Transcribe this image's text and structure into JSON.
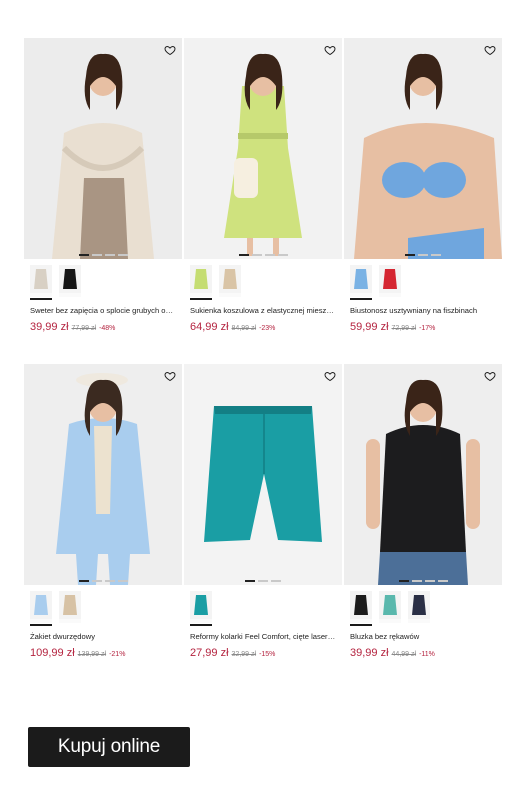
{
  "products": [
    {
      "name": "Sweter bez zapięcia o splocie grubych oc…",
      "price": "39,99 zł",
      "old_price": "77,99 zł",
      "discount": "-48%",
      "heart_icon": "heart-outline-icon",
      "photo_subject": "woman-knit-cardigan",
      "colors": {
        "bg": "#ececec",
        "main": "#e9dfd1",
        "accent": "#a99583"
      },
      "carousel_dots": 4,
      "carousel_active": 1,
      "swatches": [
        {
          "label": "beige-cardigan-swatch",
          "color": "#d8d0c4",
          "selected": true
        },
        {
          "label": "black-cardigan-swatch",
          "color": "#161616",
          "selected": false
        }
      ]
    },
    {
      "name": "Sukienka koszulowa z elastycznej miesza…",
      "price": "64,99 zł",
      "old_price": "84,99 zł",
      "discount": "-23%",
      "heart_icon": "heart-outline-icon",
      "photo_subject": "woman-lime-shirt-dress",
      "colors": {
        "bg": "#f2f2f2",
        "main": "#cfe27e",
        "accent": "#b6c96a"
      },
      "carousel_dots": 4,
      "carousel_active": 1,
      "swatches": [
        {
          "label": "lime-dress-swatch",
          "color": "#c5dd72",
          "selected": true
        },
        {
          "label": "beige-dress-swatch",
          "color": "#d9c4a6",
          "selected": false
        }
      ]
    },
    {
      "name": "Biustonosz usztywniany na fiszbinach",
      "price": "59,99 zł",
      "old_price": "72,99 zł",
      "discount": "-17%",
      "heart_icon": "heart-outline-icon",
      "photo_subject": "woman-blue-bra",
      "colors": {
        "bg": "#eeeeee",
        "main": "#6fa6de",
        "accent": "#c89272"
      },
      "carousel_dots": 3,
      "carousel_active": 1,
      "swatches": [
        {
          "label": "blue-bra-swatch",
          "color": "#7ab2e4",
          "selected": true
        },
        {
          "label": "red-bra-swatch",
          "color": "#d52631",
          "selected": false
        }
      ]
    },
    {
      "name": "Żakiet dwurzędowy",
      "price": "109,99 zł",
      "old_price": "139,99 zł",
      "discount": "-21%",
      "heart_icon": "heart-outline-icon",
      "photo_subject": "woman-light-blue-blazer",
      "colors": {
        "bg": "#eeeeee",
        "main": "#a9cdee",
        "accent": "#ece2cf"
      },
      "carousel_dots": 4,
      "carousel_active": 1,
      "swatches": [
        {
          "label": "light-blue-blazer-swatch",
          "color": "#a9cdee",
          "selected": true
        },
        {
          "label": "beige-blazer-swatch",
          "color": "#d7c2a5",
          "selected": false
        }
      ]
    },
    {
      "name": "Reformy kolarki Feel Comfort, cięte laser…",
      "price": "27,99 zł",
      "old_price": "32,99 zł",
      "discount": "-15%",
      "heart_icon": "heart-outline-icon",
      "photo_subject": "teal-cycling-shorts",
      "colors": {
        "bg": "#f3f3f3",
        "main": "#1a9ea4",
        "accent": "#137f85"
      },
      "carousel_dots": 3,
      "carousel_active": 1,
      "swatches": [
        {
          "label": "teal-shorts-swatch",
          "color": "#1a9ea4",
          "selected": true
        }
      ]
    },
    {
      "name": "Bluzka bez rękawów",
      "price": "39,99 zł",
      "old_price": "44,99 zł",
      "discount": "-11%",
      "heart_icon": "heart-outline-icon",
      "photo_subject": "woman-black-sleeveless-blouse",
      "colors": {
        "bg": "#eeeeee",
        "main": "#1c1c1e",
        "accent": "#4c6f98"
      },
      "carousel_dots": 4,
      "carousel_active": 1,
      "swatches": [
        {
          "label": "black-blouse-swatch",
          "color": "#1c1c1c",
          "selected": true
        },
        {
          "label": "teal-blouse-swatch",
          "color": "#5ab8ad",
          "selected": false
        },
        {
          "label": "navy-blouse-swatch",
          "color": "#2a2f45",
          "selected": false
        }
      ]
    }
  ],
  "cta": {
    "label": "Kupuj online"
  }
}
